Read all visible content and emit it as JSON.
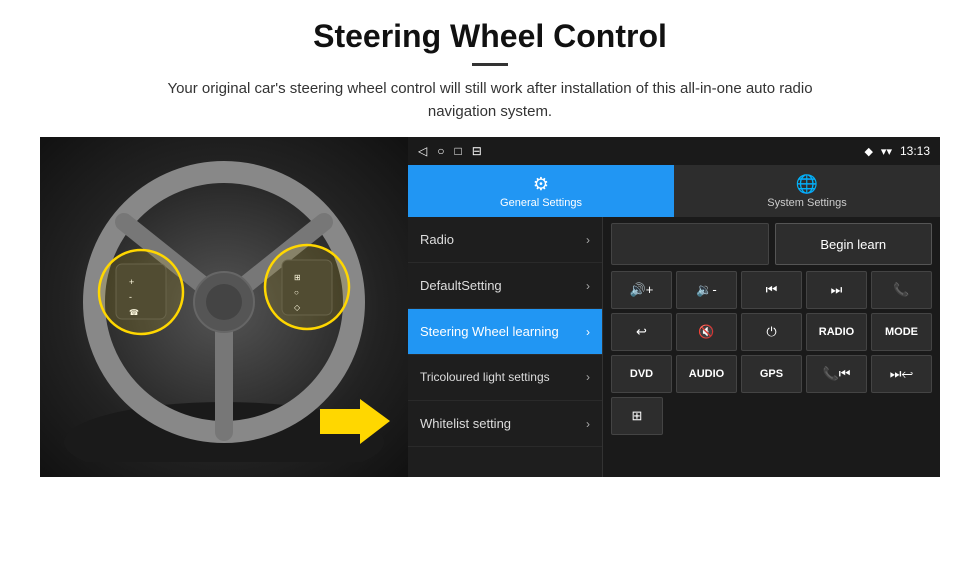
{
  "header": {
    "title": "Steering Wheel Control",
    "divider": true,
    "subtitle": "Your original car's steering wheel control will still work after installation of this all-in-one auto radio navigation system."
  },
  "status_bar": {
    "left_icons": [
      "◁",
      "○",
      "□",
      "⊟"
    ],
    "signal_icon": "◆",
    "wifi_icon": "▾",
    "time": "13:13"
  },
  "tabs": [
    {
      "id": "general",
      "label": "General Settings",
      "active": true,
      "icon": "⚙"
    },
    {
      "id": "system",
      "label": "System Settings",
      "active": false,
      "icon": "⚙"
    }
  ],
  "menu_items": [
    {
      "id": "radio",
      "label": "Radio",
      "active": false
    },
    {
      "id": "default",
      "label": "DefaultSetting",
      "active": false
    },
    {
      "id": "steering",
      "label": "Steering Wheel learning",
      "active": true
    },
    {
      "id": "tricoloured",
      "label": "Tricoloured light settings",
      "active": false
    },
    {
      "id": "whitelist",
      "label": "Whitelist setting",
      "active": false
    }
  ],
  "control_panel": {
    "begin_learn_label": "Begin learn",
    "rows": [
      [
        "vol+",
        "vol-",
        "prev",
        "next",
        "phone"
      ],
      [
        "pickup",
        "mute",
        "power",
        "radio",
        "mode"
      ],
      [
        "dvd",
        "audio",
        "gps",
        "phone+prev",
        "skip+next"
      ],
      [
        "media_icon"
      ]
    ]
  }
}
